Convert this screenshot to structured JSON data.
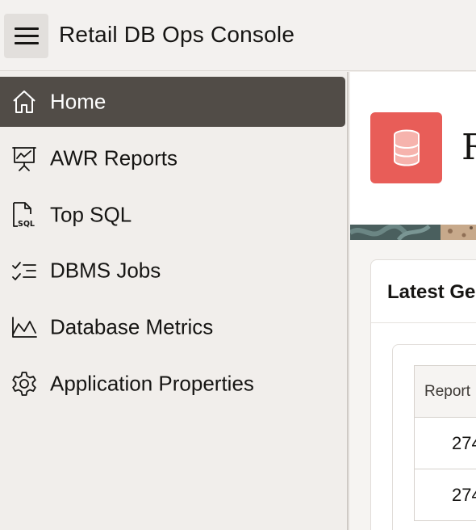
{
  "header": {
    "app_title": "Retail DB Ops Console",
    "menu_icon": "hamburger-menu-icon"
  },
  "sidebar": {
    "items": [
      {
        "label": "Home",
        "icon": "home-icon",
        "active": true
      },
      {
        "label": "AWR Reports",
        "icon": "presentation-chart-icon",
        "active": false
      },
      {
        "label": "Top SQL",
        "icon": "sql-file-icon",
        "active": false
      },
      {
        "label": "DBMS Jobs",
        "icon": "checklist-icon",
        "active": false
      },
      {
        "label": "Database Metrics",
        "icon": "line-chart-icon",
        "active": false
      },
      {
        "label": "Application Properties",
        "icon": "gear-icon",
        "active": false
      }
    ]
  },
  "main": {
    "hero": {
      "icon": "database-icon",
      "icon_bg": "#e85d58",
      "title_visible": "R"
    },
    "card": {
      "title_visible": "Latest Ge",
      "table": {
        "header_visible": "Report",
        "rows_visible": [
          "274",
          "274"
        ]
      }
    }
  },
  "colors": {
    "active_nav_bg": "#514c47",
    "sidebar_bg": "#f1eeeb",
    "accent_red": "#e85d58"
  }
}
